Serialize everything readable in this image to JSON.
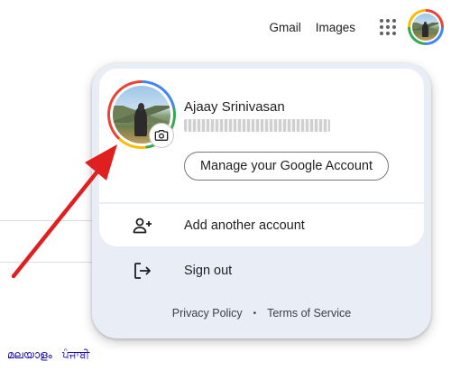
{
  "topbar": {
    "gmail_label": "Gmail",
    "images_label": "Images",
    "apps_icon": "apps-grid-icon",
    "avatar_icon": "profile-avatar"
  },
  "account_menu": {
    "name": "Ajaay Srinivasan",
    "camera_icon": "camera-icon",
    "manage_label": "Manage your Google Account",
    "add_account_label": "Add another account",
    "sign_out_label": "Sign out",
    "privacy_label": "Privacy Policy",
    "separator": "•",
    "terms_label": "Terms of Service"
  },
  "page": {
    "languages": [
      "മലയാളം",
      "ਪੰਜਾਬੀ"
    ]
  },
  "colors": {
    "panel_bg": "#e9eef6",
    "card_bg": "#ffffff",
    "arrow": "#e02020",
    "google_red": "#ea4335",
    "google_blue": "#4285f4",
    "google_green": "#34a853",
    "google_yellow": "#fbbc05"
  }
}
